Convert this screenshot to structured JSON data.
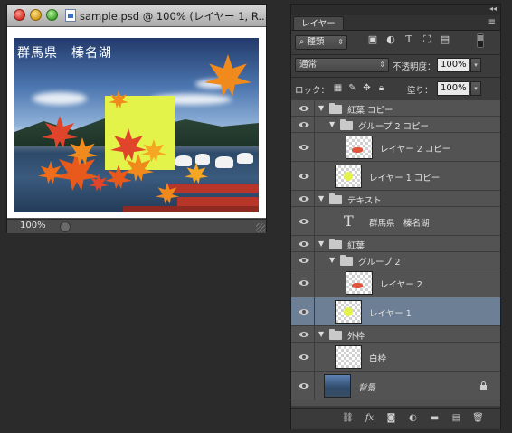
{
  "document": {
    "title": "sample.psd @ 100% (レイヤー 1, R...",
    "canvas_text": "群馬県　榛名湖",
    "zoom": "100%"
  },
  "panel": {
    "tab": "レイヤー",
    "filter_kind": "種類",
    "blend_mode": "通常",
    "opacity_label": "不透明度：",
    "opacity_value": "100%",
    "lock_label": "ロック：",
    "fill_label": "塗り：",
    "fill_value": "100%"
  },
  "layers": [
    {
      "name": "紅葉 コピー",
      "type": "group",
      "indent": 0,
      "expanded": true
    },
    {
      "name": "グループ 2 コピー",
      "type": "group",
      "indent": 1,
      "expanded": true
    },
    {
      "name": "レイヤー 2 コピー",
      "type": "pixel",
      "indent": 2,
      "thumb": "leaves"
    },
    {
      "name": "レイヤー 1 コピー",
      "type": "pixel",
      "indent": 1,
      "thumb": "yellow"
    },
    {
      "name": "テキスト",
      "type": "group",
      "indent": 0,
      "expanded": true
    },
    {
      "name": "群馬県　榛名湖",
      "type": "text",
      "indent": 1
    },
    {
      "name": "紅葉",
      "type": "group",
      "indent": 0,
      "expanded": true
    },
    {
      "name": "グループ 2",
      "type": "group",
      "indent": 1,
      "expanded": true
    },
    {
      "name": "レイヤー 2",
      "type": "pixel",
      "indent": 2,
      "thumb": "leaves"
    },
    {
      "name": "レイヤー 1",
      "type": "pixel",
      "indent": 1,
      "thumb": "yellow",
      "selected": true
    },
    {
      "name": "外枠",
      "type": "group",
      "indent": 0,
      "expanded": true
    },
    {
      "name": "白枠",
      "type": "pixel",
      "indent": 1,
      "thumb": "empty"
    },
    {
      "name": "背景",
      "type": "background",
      "indent": 0,
      "locked": true
    }
  ],
  "colors": {
    "selected_row": "#6d7f95",
    "leaf_orange": "#f08a1c",
    "leaf_red": "#e0442a",
    "yellow_rect": "#e3f34a"
  },
  "icons": {
    "filter": "search-icon",
    "bottom_bar": [
      "link-icon",
      "fx-icon",
      "mask-icon",
      "adjustment-icon",
      "new-group-icon",
      "new-layer-icon",
      "trash-icon"
    ]
  }
}
